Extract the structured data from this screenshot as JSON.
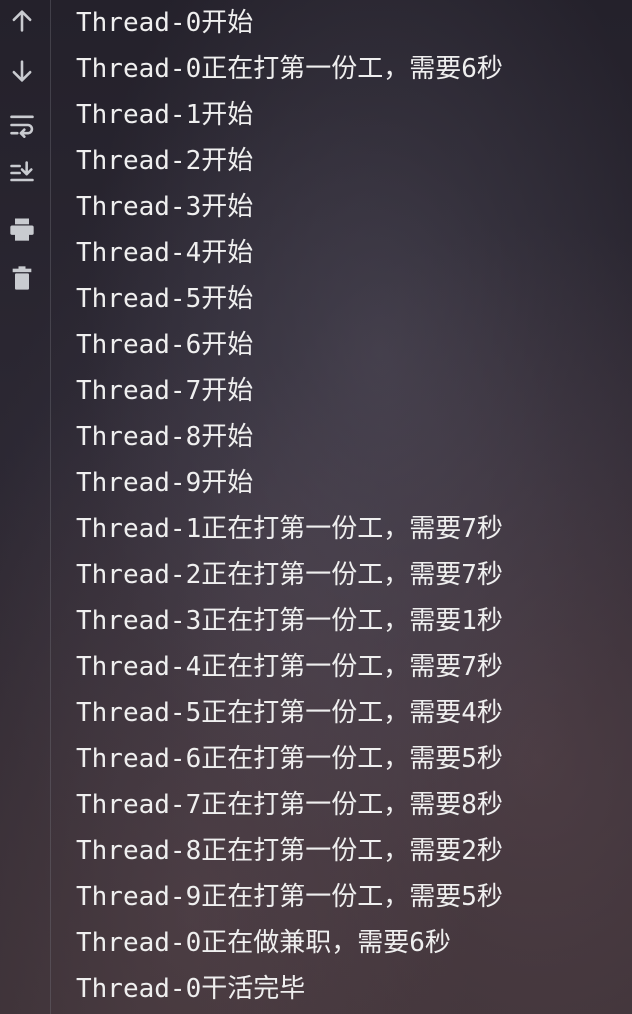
{
  "toolbar": {
    "icons": [
      "up-arrow-icon",
      "down-arrow-icon",
      "soft-wrap-icon",
      "scroll-to-end-icon",
      "print-icon",
      "trash-icon"
    ]
  },
  "output": {
    "lines": [
      "Thread-0开始",
      "Thread-0正在打第一份工，需要6秒",
      "Thread-1开始",
      "Thread-2开始",
      "Thread-3开始",
      "Thread-4开始",
      "Thread-5开始",
      "Thread-6开始",
      "Thread-7开始",
      "Thread-8开始",
      "Thread-9开始",
      "Thread-1正在打第一份工，需要7秒",
      "Thread-2正在打第一份工，需要7秒",
      "Thread-3正在打第一份工，需要1秒",
      "Thread-4正在打第一份工，需要7秒",
      "Thread-5正在打第一份工，需要4秒",
      "Thread-6正在打第一份工，需要5秒",
      "Thread-7正在打第一份工，需要8秒",
      "Thread-8正在打第一份工，需要2秒",
      "Thread-9正在打第一份工，需要5秒",
      "Thread-0正在做兼职，需要6秒",
      "Thread-0干活完毕"
    ]
  },
  "colors": {
    "text": "#efefef",
    "icon": "#c9cbd0",
    "background": "#2a2630"
  }
}
